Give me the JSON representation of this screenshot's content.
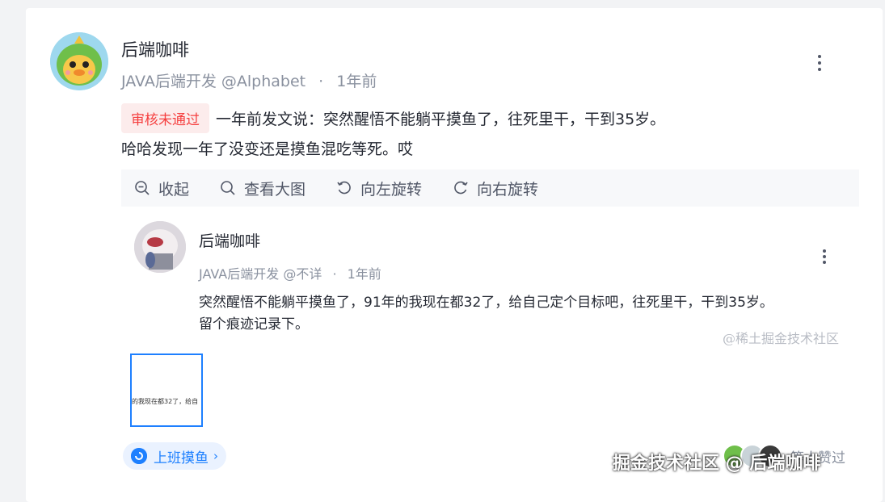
{
  "post": {
    "author_name": "后端咖啡",
    "author_title": "JAVA后端开发",
    "author_handle": "@Alphabet",
    "separator": "·",
    "time": "1年前",
    "status_badge": "审核未通过",
    "content_line1": "一年前发文说：突然醒悟不能躺平摸鱼了，往死里干，干到35岁。",
    "content_line2": "哈哈发现一年了没变还是摸鱼混吃等死。哎"
  },
  "toolbar": {
    "collapse": "收起",
    "view_large": "查看大图",
    "rotate_left": "向左旋转",
    "rotate_right": "向右旋转"
  },
  "quoted": {
    "author_name": "后端咖啡",
    "author_title": "JAVA后端开发",
    "author_handle": "@不详",
    "separator": "·",
    "time": "1年前",
    "content_line1": "突然醒悟不能躺平摸鱼了，91年的我现在都32了，给自己定个目标吧，往死里干，干到35岁。",
    "content_line2": "留个痕迹记录下。",
    "watermark": "@稀土掘金技术社区"
  },
  "thumbnail": {
    "text": "的我现在都32了，给自"
  },
  "topic": {
    "label": "上班摸鱼",
    "chevron": "›"
  },
  "likes": {
    "text": "等人赞过"
  },
  "site_watermark": "掘金技术社区 @ 后端咖啡",
  "colors": {
    "accent": "#1e80ff",
    "badge_text": "#f53f3f",
    "badge_bg": "#fcecec",
    "meta": "#8a919f"
  }
}
